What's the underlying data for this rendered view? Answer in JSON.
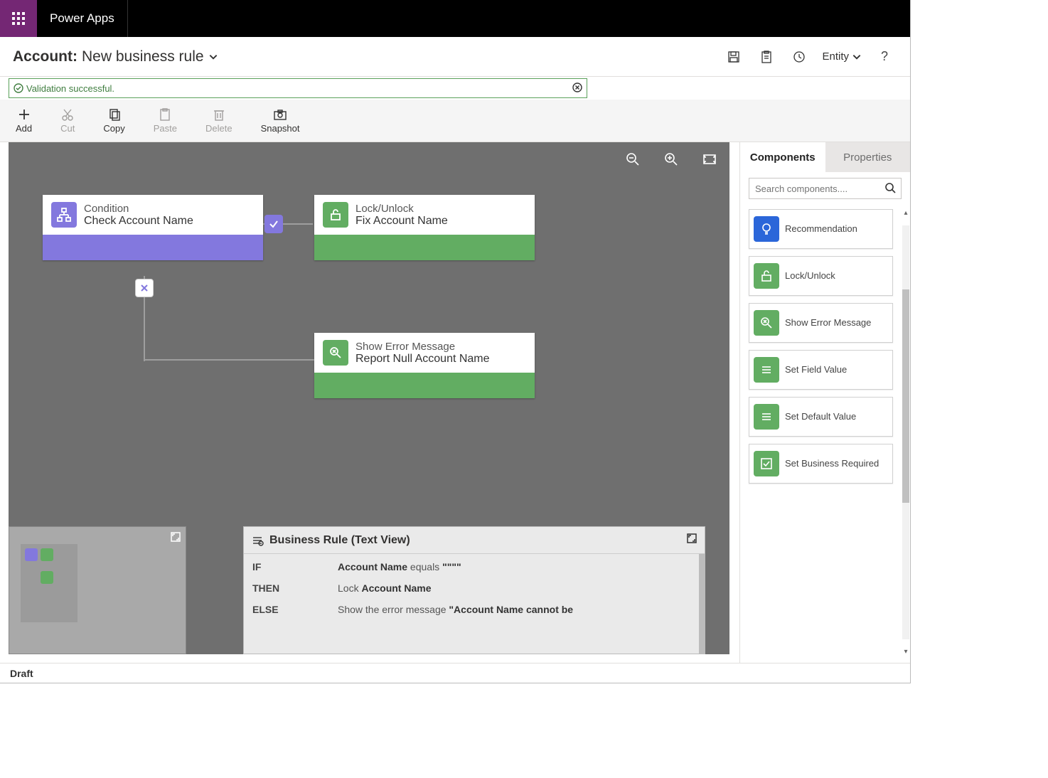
{
  "app_title": "Power Apps",
  "header": {
    "entity": "Account:",
    "rule_name": "New business rule",
    "save_tip": "Save",
    "validate_tip": "Validate",
    "scope_label": "Entity",
    "help": "?"
  },
  "message": "Validation successful.",
  "toolbar": {
    "add": "Add",
    "cut": "Cut",
    "copy": "Copy",
    "paste": "Paste",
    "delete": "Delete",
    "snapshot": "Snapshot"
  },
  "canvas": {
    "node_condition": {
      "type": "Condition",
      "name": "Check Account Name"
    },
    "node_lock": {
      "type": "Lock/Unlock",
      "name": "Fix Account Name"
    },
    "node_error": {
      "type": "Show Error Message",
      "name": "Report Null Account Name"
    }
  },
  "textview": {
    "title": "Business Rule (Text View)",
    "if": "IF",
    "if_field": "Account Name",
    "if_op": "equals",
    "if_val": "\"\"\"\"",
    "then": "THEN",
    "then_action": "Lock",
    "then_field": "Account Name",
    "else": "ELSE",
    "else_prefix": "Show the error message",
    "else_msg": "\"Account Name cannot be"
  },
  "rpanel": {
    "tab_components": "Components",
    "tab_properties": "Properties",
    "search_placeholder": "Search components....",
    "items": {
      "recommend": "Recommendation",
      "lock": "Lock/Unlock",
      "error": "Show Error Message",
      "setval": "Set Field Value",
      "defval": "Set Default Value",
      "bizreq": "Set Business Required"
    }
  },
  "footer": {
    "status": "Draft"
  }
}
